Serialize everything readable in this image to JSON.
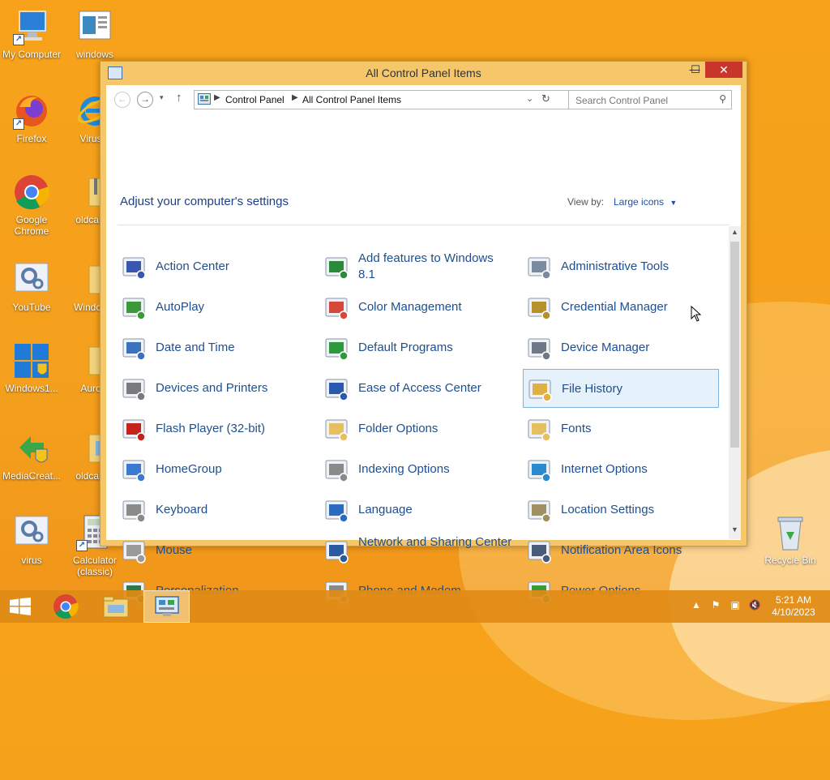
{
  "desktop": {
    "icons": [
      {
        "label": "My Computer"
      },
      {
        "label": "windows"
      },
      {
        "label": "Firefox"
      },
      {
        "label": "Virus..."
      },
      {
        "label": "Google Chrome"
      },
      {
        "label": "oldcalc..."
      },
      {
        "label": "YouTube"
      },
      {
        "label": "Window..."
      },
      {
        "label": "Windows1..."
      },
      {
        "label": "Auro..."
      },
      {
        "label": "MediaCreat..."
      },
      {
        "label": "oldcalc..."
      },
      {
        "label": "virus"
      },
      {
        "label": "Calculator (classic)"
      },
      {
        "label": "Recycle Bin"
      }
    ]
  },
  "window": {
    "title": "All Control Panel Items",
    "controls": {
      "minimize": "—",
      "maximize": "☐",
      "close": "✕"
    },
    "address": {
      "segments": [
        "Control Panel",
        "All Control Panel Items"
      ]
    },
    "search": {
      "placeholder": "Search Control Panel"
    },
    "headline": "Adjust your computer's settings",
    "view_by": {
      "label": "View by:",
      "value": "Large icons"
    },
    "items": [
      {
        "label": "Action Center",
        "icon": "action-center-flag-icon",
        "color": "#3a56b0"
      },
      {
        "label": "Add features to Windows 8.1",
        "icon": "add-features-icon",
        "color": "#2a8a3a"
      },
      {
        "label": "Administrative Tools",
        "icon": "admin-tools-icon",
        "color": "#7a8aa0"
      },
      {
        "label": "AutoPlay",
        "icon": "autoplay-icon",
        "color": "#3a9a3a"
      },
      {
        "label": "Color Management",
        "icon": "color-management-icon",
        "color": "#d8483a"
      },
      {
        "label": "Credential Manager",
        "icon": "credential-manager-icon",
        "color": "#b8902a"
      },
      {
        "label": "Date and Time",
        "icon": "date-time-icon",
        "color": "#3a72c0"
      },
      {
        "label": "Default Programs",
        "icon": "default-programs-icon",
        "color": "#2a9a3a"
      },
      {
        "label": "Device Manager",
        "icon": "device-manager-icon",
        "color": "#707888"
      },
      {
        "label": "Devices and Printers",
        "icon": "devices-printers-icon",
        "color": "#7a7a7a"
      },
      {
        "label": "Ease of Access Center",
        "icon": "ease-of-access-icon",
        "color": "#2a5ab0"
      },
      {
        "label": "File History",
        "icon": "file-history-icon",
        "color": "#e0b040"
      },
      {
        "label": "Flash Player (32-bit)",
        "icon": "flash-player-icon",
        "color": "#c4221a"
      },
      {
        "label": "Folder Options",
        "icon": "folder-options-icon",
        "color": "#e6c060"
      },
      {
        "label": "Fonts",
        "icon": "fonts-icon",
        "color": "#e6c060"
      },
      {
        "label": "HomeGroup",
        "icon": "homegroup-icon",
        "color": "#3a7ad0"
      },
      {
        "label": "Indexing Options",
        "icon": "indexing-options-icon",
        "color": "#8a8a8a"
      },
      {
        "label": "Internet Options",
        "icon": "internet-options-icon",
        "color": "#2a8ad0"
      },
      {
        "label": "Keyboard",
        "icon": "keyboard-icon",
        "color": "#8a8a8a"
      },
      {
        "label": "Language",
        "icon": "language-icon",
        "color": "#2a6ac0"
      },
      {
        "label": "Location Settings",
        "icon": "location-settings-icon",
        "color": "#a09060"
      },
      {
        "label": "Mouse",
        "icon": "mouse-icon",
        "color": "#9a9a9a"
      },
      {
        "label": "Network and Sharing Center",
        "icon": "network-sharing-icon",
        "color": "#2a5aa0"
      },
      {
        "label": "Notification Area Icons",
        "icon": "notification-area-icon",
        "color": "#4a5a7a"
      },
      {
        "label": "Personalization",
        "icon": "personalization-icon",
        "color": "#2a7a4a"
      },
      {
        "label": "Phone and Modem",
        "icon": "phone-modem-icon",
        "color": "#8a8a8a"
      },
      {
        "label": "Power Options",
        "icon": "power-options-icon",
        "color": "#3a9a3a"
      }
    ]
  },
  "taskbar": {
    "clock_time": "5:21 AM",
    "clock_date": "4/10/2023"
  }
}
